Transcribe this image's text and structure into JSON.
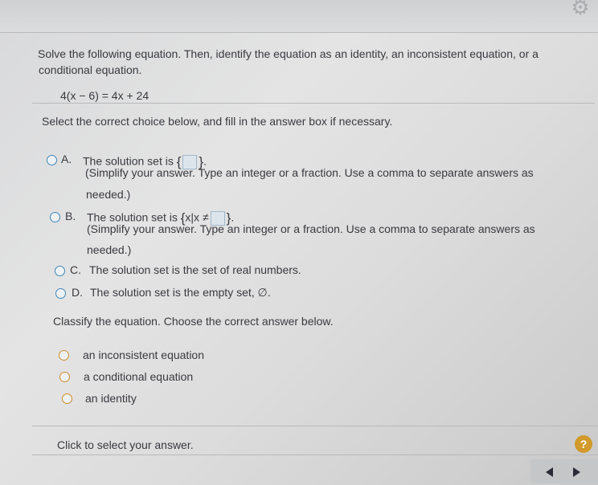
{
  "question": {
    "prompt_line1": "Solve the following equation. Then, identify the equation as an identity, an inconsistent equation, or a",
    "prompt_line2": "conditional equation.",
    "equation": "4(x − 6) = 4x + 24",
    "instruction": "Select the correct choice below, and fill in the answer box if necessary."
  },
  "choices": [
    {
      "letter": "A.",
      "text": "The solution set is",
      "sub1": "(Simplify your answer. Type an integer or a fraction. Use a comma to separate answers as",
      "sub2": "needed.)"
    },
    {
      "letter": "B.",
      "text": "The solution set is",
      "setbuilder": "x|x ≠",
      "sub1": "(Simplify your answer. Type an integer or a fraction. Use a comma to separate answers as",
      "sub2": "needed.)"
    },
    {
      "letter": "C.",
      "text": "The solution set is the set of real numbers."
    },
    {
      "letter": "D.",
      "text": "The solution set is the empty set, ∅."
    }
  ],
  "classify": {
    "prompt": "Classify the equation. Choose the correct answer below.",
    "options": [
      "an inconsistent equation",
      "a conditional equation",
      "an identity"
    ]
  },
  "footer": {
    "status": "Click to select your answer.",
    "help": "?"
  },
  "icons": {
    "settings": "gear-icon",
    "help": "help-icon",
    "prev": "arrow-left-icon",
    "next": "arrow-right-icon"
  },
  "colors": {
    "radio_blue": "#3f86b8",
    "radio_orange": "#d08b2e",
    "help_badge": "#d19a2b"
  }
}
